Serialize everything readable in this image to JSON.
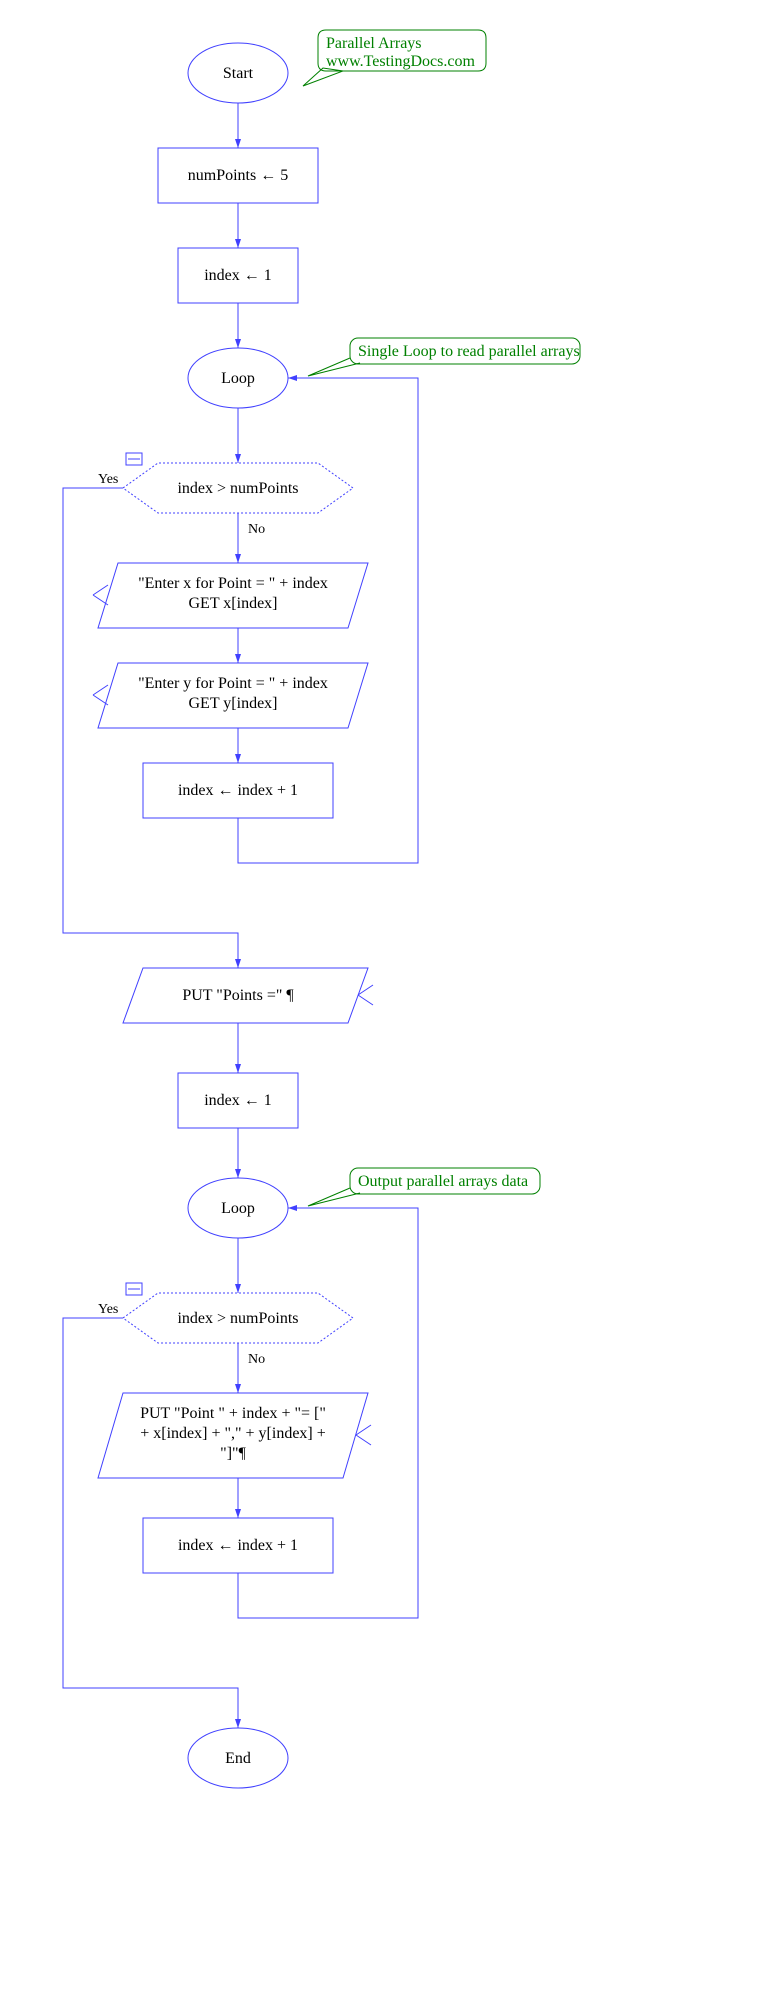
{
  "annotations": {
    "title_line1": "Parallel Arrays",
    "title_line2": "www.TestingDocs.com",
    "loop1_note": "Single Loop to read parallel arrays",
    "loop2_note": "Output parallel arrays data"
  },
  "nodes": {
    "start": "Start",
    "assign_numpoints": "numPoints ← 5",
    "assign_index1": "index ← 1",
    "loop1": "Loop",
    "decision1": "index > numPoints",
    "input_x_line1": "\"Enter x for Point = \"  + index",
    "input_x_line2": "GET x[index]",
    "input_y_line1": "\"Enter y for Point = \"  + index",
    "input_y_line2": "GET y[index]",
    "increment1": "index ← index  +  1",
    "output_points": "PUT \"Points =\" ¶",
    "assign_index2": "index ← 1",
    "loop2": "Loop",
    "decision2": "index > numPoints",
    "output_point_line1": "PUT \"Point  \" + index + \"= [\"",
    "output_point_line2": "+ x[index] + \",\" + y[index] +",
    "output_point_line3": "\"]\"¶",
    "increment2": "index ← index  +  1",
    "end": "End"
  },
  "labels": {
    "yes": "Yes",
    "no": "No"
  }
}
